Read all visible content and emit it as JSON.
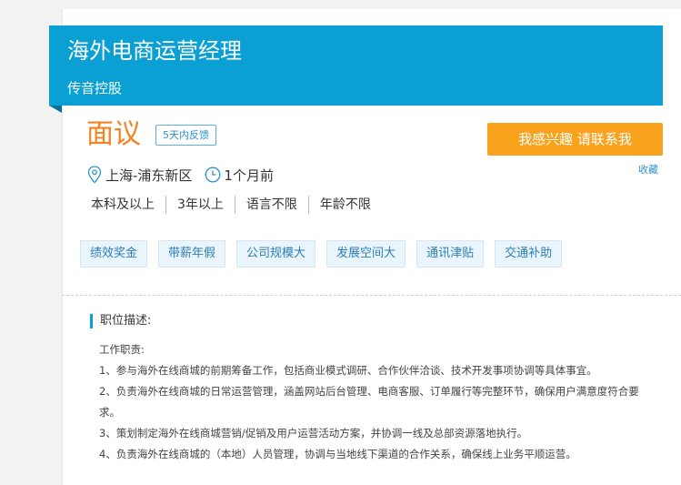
{
  "job": {
    "title": "海外电商运营经理",
    "company": "传音控股",
    "salary": "面议",
    "feedback_badge": "5天内反馈",
    "location": "上海-浦东新区",
    "posted": "1个月前"
  },
  "actions": {
    "interest_label": "我感兴趣 请联系我",
    "favorite_label": "收藏"
  },
  "requirements": [
    "本科及以上",
    "3年以上",
    "语言不限",
    "年龄不限"
  ],
  "tags": [
    "绩效奖金",
    "带薪年假",
    "公司规模大",
    "发展空间大",
    "通讯津贴",
    "交通补助"
  ],
  "description": {
    "section_title": "职位描述:",
    "heading": "工作职责:",
    "lines": [
      "1、参与海外在线商城的前期筹备工作，包括商业模式调研、合作伙伴洽谈、技术开发事项协调等具体事宜。",
      "2、负责海外在线商城的日常运营管理，涵盖网站后台管理、电商客服、订单履行等完整环节，确保用户满意度符合要求。",
      "3、策划制定海外在线商城营销/促销及用户运营活动方案，并协调一线及总部资源落地执行。",
      "4、负责海外在线商城的（本地）人员管理，协调与当地线下渠道的合作关系，确保线上业务平顺运营。"
    ]
  },
  "colors": {
    "banner": "#0aa0d4",
    "salary": "#f5821f",
    "interest_button": "#f9a21b",
    "link": "#2a93cf"
  },
  "icons": {
    "location": "location-pin-icon",
    "time": "clock-icon"
  }
}
